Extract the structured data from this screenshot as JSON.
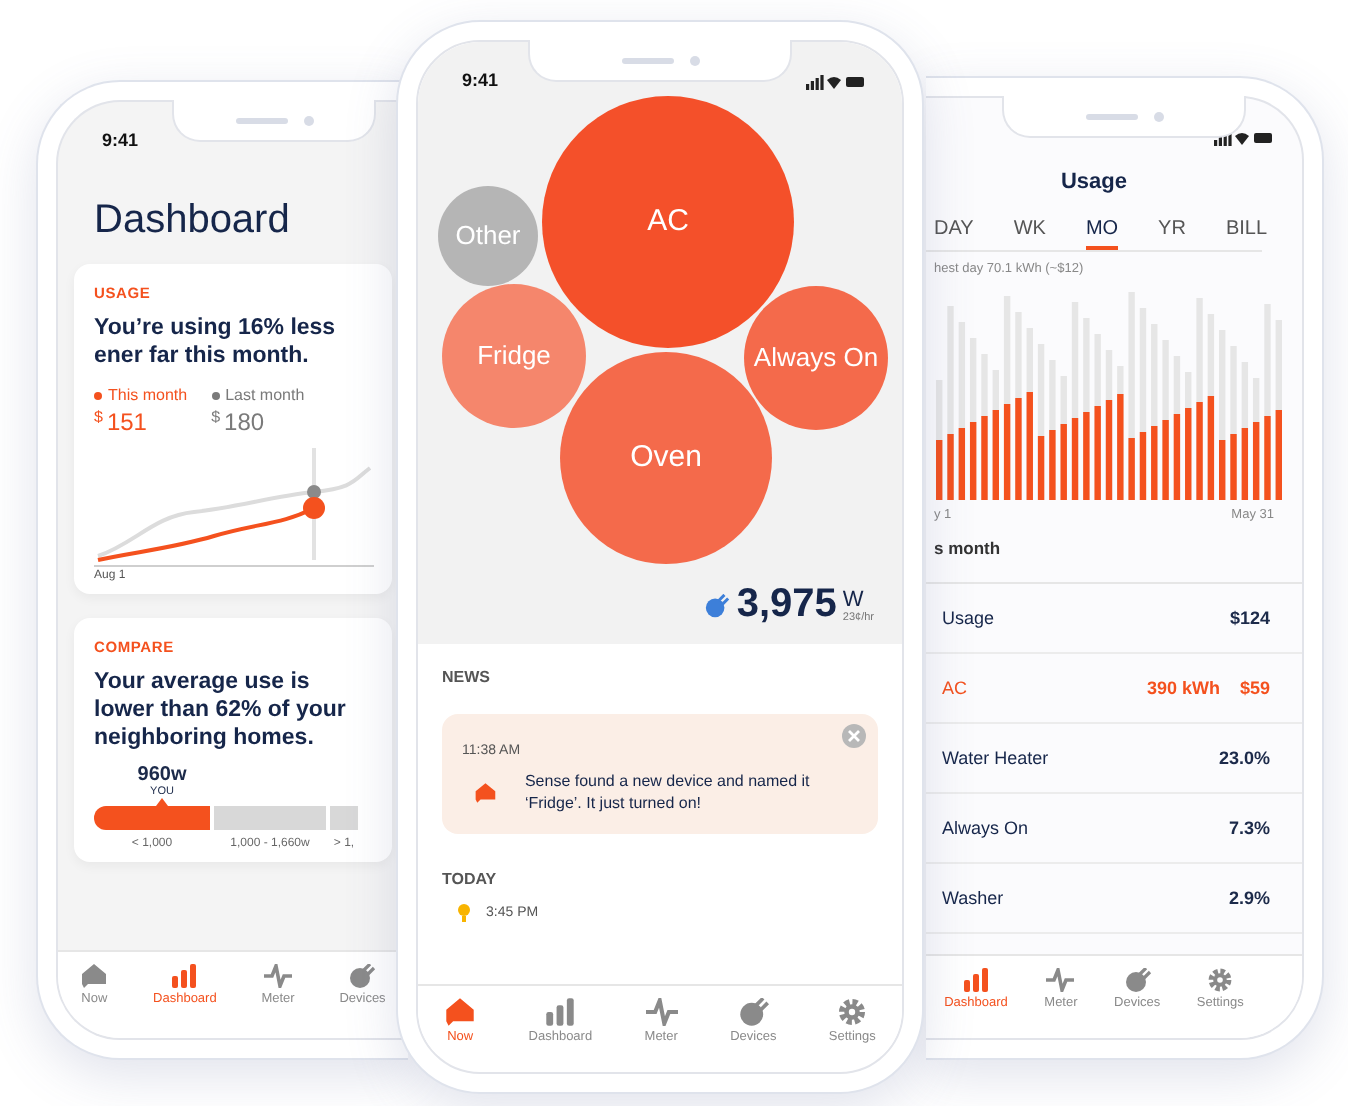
{
  "left_phone": {
    "status_time": "9:41",
    "title": "Dashboard",
    "usage_card": {
      "label": "USAGE",
      "headline": "You’re using 16% less ener far this month.",
      "legend": [
        {
          "label": "This month",
          "color": "#f4511e",
          "currency": "$",
          "amount": "151"
        },
        {
          "label": "Last month",
          "color": "#7a7a7a",
          "currency": "$",
          "amount": "180"
        }
      ],
      "axis_label": "Aug 1"
    },
    "compare_card": {
      "label": "COMPARE",
      "headline": "Your average use is lower than 62% of your neighboring homes.",
      "marker_value": "960w",
      "marker_label": "YOU",
      "segments": [
        {
          "label": "< 1,000",
          "selected": true
        },
        {
          "label": "1,000 - 1,660w",
          "selected": false
        },
        {
          "label": "> 1,",
          "selected": false
        }
      ]
    },
    "tab_bar": [
      {
        "kind": "now",
        "label": "Now",
        "selected": false
      },
      {
        "kind": "dashboard",
        "label": "Dashboard",
        "selected": true
      },
      {
        "kind": "meter",
        "label": "Meter",
        "selected": false
      },
      {
        "kind": "devices",
        "label": "Devices",
        "selected": false
      }
    ]
  },
  "middle_phone": {
    "status_time": "9:41",
    "bubbles": [
      {
        "label": "Other",
        "color": "#b5b5b5"
      },
      {
        "label": "AC",
        "color": "#f4502a"
      },
      {
        "label": "Fridge",
        "color": "#f5866c"
      },
      {
        "label": "Always On",
        "color": "#f46a4b"
      },
      {
        "label": "Oven",
        "color": "#f46a4b"
      }
    ],
    "power": {
      "value": "3,975",
      "unit": "W",
      "rate": "23¢/hr"
    },
    "news": {
      "heading": "NEWS",
      "items": [
        {
          "time": "11:38 AM",
          "message": "Sense found a new device and named it ‘Fridge’. It just turned on!"
        }
      ]
    },
    "today": {
      "heading": "TODAY",
      "items": [
        {
          "time": "3:45 PM"
        }
      ]
    },
    "tab_bar": [
      {
        "kind": "now",
        "label": "Now",
        "selected": true
      },
      {
        "kind": "dashboard",
        "label": "Dashboard",
        "selected": false
      },
      {
        "kind": "meter",
        "label": "Meter",
        "selected": false
      },
      {
        "kind": "devices",
        "label": "Devices",
        "selected": false
      },
      {
        "kind": "settings",
        "label": "Settings",
        "selected": false
      }
    ]
  },
  "right_phone": {
    "title": "Usage",
    "periods": [
      {
        "label": "DAY",
        "selected": false
      },
      {
        "label": "WK",
        "selected": false
      },
      {
        "label": "MO",
        "selected": true
      },
      {
        "label": "YR",
        "selected": false
      },
      {
        "label": "BILL",
        "selected": false
      }
    ],
    "chart_caption": "hest day 70.1 kWh (~$12)",
    "axis_start": "y 1",
    "axis_end": "May 31",
    "section_label": "s month",
    "rows": [
      {
        "label": "Usage",
        "values": [
          "$124"
        ],
        "highlighted": false
      },
      {
        "label": "AC",
        "values": [
          "390 kWh",
          "$59"
        ],
        "highlighted": true
      },
      {
        "label": "Water Heater",
        "values": [
          "23.0%"
        ],
        "highlighted": false
      },
      {
        "label": "Always On",
        "values": [
          "7.3%"
        ],
        "highlighted": false
      },
      {
        "label": "Washer",
        "values": [
          "2.9%"
        ],
        "highlighted": false
      }
    ],
    "tab_bar": [
      {
        "kind": "dashboard",
        "label": "Dashboard",
        "selected": true
      },
      {
        "kind": "meter",
        "label": "Meter",
        "selected": false
      },
      {
        "kind": "devices",
        "label": "Devices",
        "selected": false
      },
      {
        "kind": "settings",
        "label": "Settings",
        "selected": false
      }
    ]
  }
}
